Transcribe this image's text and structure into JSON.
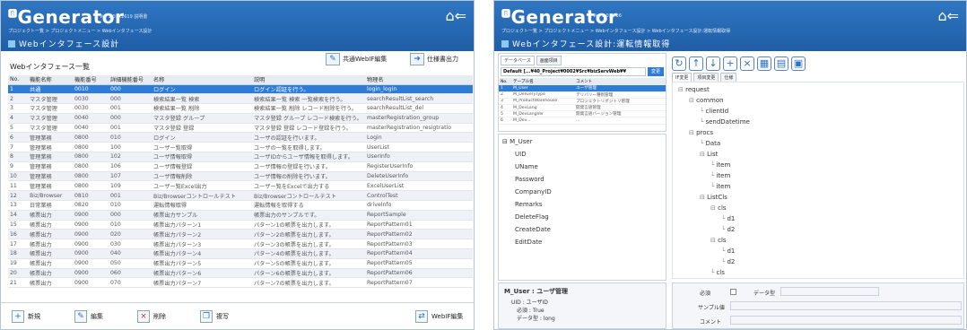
{
  "left": {
    "logo": "Generator",
    "version": "Ver 1.0.0.2619 説明書",
    "breadcrumb": "プロジェクト一覧 > プロジェクトメニュー > Webインタフェース設計",
    "title": "Webインタフェース設計",
    "section": "Webインタフェース一覧",
    "btn_common": "共通WebIF編集",
    "btn_spec": "仕様書出力",
    "columns": [
      "No.",
      "機能名称",
      "機能番号",
      "詳細機能番号",
      "名称",
      "説明",
      "物理名"
    ],
    "rows": [
      [
        "1",
        "共通",
        "0010",
        "000",
        "ログイン",
        "ログイン認証を行う。",
        "login_login"
      ],
      [
        "2",
        "マスタ管理",
        "0030",
        "000",
        "検索結果一覧 検索",
        "検索結果一覧 検索 一覧検索を行う。",
        "searchResultList_search"
      ],
      [
        "3",
        "マスタ管理",
        "0030",
        "001",
        "検索結果一覧 削除",
        "検索結果一覧 削除 レコード削除を行う。",
        "searchResultList_del"
      ],
      [
        "4",
        "マスタ管理",
        "0040",
        "000",
        "マスタ登録 グループ",
        "マスタ登録 グループ レコード検索を行う。",
        "masterRegistration_group"
      ],
      [
        "5",
        "マスタ管理",
        "0040",
        "001",
        "マスタ登録 登録",
        "マスタ登録 登録 レコード登録を行う。",
        "masterRegistration_resigtratio"
      ],
      [
        "6",
        "管理業務",
        "0800",
        "010",
        "ログイン",
        "ユーザの認証を行います。",
        "Login"
      ],
      [
        "7",
        "管理業務",
        "0800",
        "100",
        "ユーザー覧取得",
        "ユーザの一覧を取得します。",
        "UserList"
      ],
      [
        "8",
        "管理業務",
        "0800",
        "102",
        "ユーザ情報取得",
        "ユーザIDからユーザ情報を取得します。",
        "UserInfo"
      ],
      [
        "9",
        "管理業務",
        "0800",
        "106",
        "ユーザ情報登録",
        "ユーザ情報の登録を行います。",
        "RegisterUserInfo"
      ],
      [
        "10",
        "管理業務",
        "0800",
        "107",
        "ユーザ情報削除",
        "ユーザ情報の削除を行います。",
        "DeleteUserInfo"
      ],
      [
        "11",
        "管理業務",
        "0800",
        "109",
        "ユーザー覧Excel出力",
        "ユーザー覧をExcelで出力する",
        "ExcelUserList"
      ],
      [
        "12",
        "Biz/Browser",
        "0810",
        "001",
        "Biz/Browserコントロールテスト",
        "Biz/Browserコントロールテスト",
        "ControlTest"
      ],
      [
        "13",
        "日常業務",
        "0820",
        "010",
        "運転情報取得",
        "運転情報を取得する",
        "driveInfo"
      ],
      [
        "14",
        "帳票出力",
        "0900",
        "000",
        "帳票出力サンプル",
        "帳票出力のサンプルです。",
        "ReportSample"
      ],
      [
        "15",
        "帳票出力",
        "0900",
        "010",
        "帳票出力パターン1",
        "パターン1の帳票を出力します。",
        "ReportPattern01"
      ],
      [
        "16",
        "帳票出力",
        "0900",
        "020",
        "帳票出力パターン2",
        "パターン2の帳票を出力します。",
        "ReportPattern02"
      ],
      [
        "17",
        "帳票出力",
        "0900",
        "030",
        "帳票出力パターン3",
        "パターン3の帳票を出力します。",
        "ReportPattern03"
      ],
      [
        "18",
        "帳票出力",
        "0900",
        "040",
        "帳票出力パターン4",
        "パターン4の帳票を出力します。",
        "ReportPattern04"
      ],
      [
        "19",
        "帳票出力",
        "0900",
        "050",
        "帳票出力パターン5",
        "パターン5の帳票を出力します。",
        "ReportPattern05"
      ],
      [
        "20",
        "帳票出力",
        "0900",
        "060",
        "帳票出力パターン6",
        "パターン6の帳票を出力します。",
        "ReportPattern06"
      ],
      [
        "21",
        "帳票出力",
        "0900",
        "070",
        "帳票出力パターン7",
        "パターン7の帳票を出力します。",
        "ReportPattern07"
      ]
    ],
    "footer": {
      "new": "新規",
      "edit": "編集",
      "delete": "削除",
      "copy": "複写",
      "webif": "WebIF編集"
    }
  },
  "right": {
    "logo": "Generator",
    "version": "Ver 1.0.2736",
    "breadcrumb": "プロジェクト一覧 > プロジェクトメニュー > Webインタフェース設計 > Webインタフェース設計:運転情報取得",
    "title": "Webインタフェース設計:運転情報取得",
    "db_tabs": [
      "データベース",
      "画面項目"
    ],
    "db_select": "Default [...¥40_Project¥0002¥Src¥bizServWeb¥¥",
    "btn_change": "変更",
    "table_cols": [
      "No.",
      "テーブル名",
      "コメント"
    ],
    "table_rows": [
      [
        "1",
        "M_User",
        "ユーザ管理"
      ],
      [
        "2",
        "M_DeliveryType",
        "デリバリー種別管理"
      ],
      [
        "3",
        "M_ProductWarehouse",
        "プロジェクトリポジトリ管理"
      ],
      [
        "4",
        "M_DevLang",
        "開発言語管理"
      ],
      [
        "5",
        "M_DevLangVer",
        "開発言語バージョン管理"
      ],
      [
        "6",
        "M_Dev...",
        "..."
      ]
    ],
    "entity": "M_User",
    "fields": [
      "UID",
      "UName",
      "Password",
      "CompanyID",
      "Remarks",
      "DeleteFlag",
      "CreateDate",
      "EditDate"
    ],
    "detail_title": "M_User : ユーザ管理",
    "detail_lines": [
      "UID : ユーザID",
      "必須 : True",
      "データ型 : long"
    ],
    "tree_tabs": [
      "IF変更",
      "項目変更",
      "仕様"
    ],
    "tree": [
      "request",
      "common",
      "clientId",
      "sendDatetime",
      "procs",
      "Data",
      "List",
      "item",
      "item",
      "item",
      "ListCls",
      "cls",
      "d1",
      "d2",
      "cls",
      "d1",
      "d2",
      "cls"
    ],
    "props": {
      "required": "必須",
      "datatype": "データ型",
      "sample": "サンプル値",
      "comment": "コメント"
    }
  }
}
